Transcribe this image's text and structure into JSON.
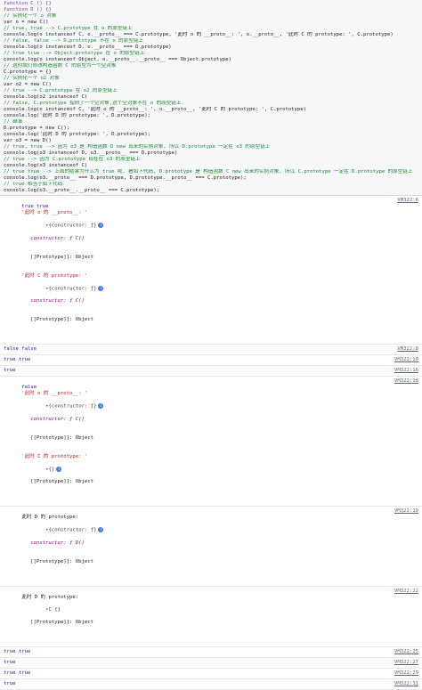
{
  "code_lines": [
    {
      "text": "function C () {}",
      "type": "kw"
    },
    {
      "text": "function D () {}",
      "type": "kw"
    },
    {
      "text": "// 实例化一个 o 对象",
      "type": "comment"
    },
    {
      "text": "var o = new C()",
      "type": "code"
    },
    {
      "text": "// true, true --> C.prototype 在 o 的原型链上",
      "type": "comment"
    },
    {
      "text": "console.log(o instanceof C, o.__proto__ === C.prototype, '此时 o 的 __proto__: ', o.__proto__, '此时 C 的 prototype: ', C.prototype)",
      "type": "code"
    },
    {
      "text": "// false, false --> D.prototype 不在 o 的原型链上",
      "type": "comment"
    },
    {
      "text": "console.log(o instanceof D, o.__proto__ === D.prototype)",
      "type": "code"
    },
    {
      "text": "// true true --> Object.prototype 在 o 的原型链上",
      "type": "comment"
    },
    {
      "text": "console.log(o instanceof Object, o.__proto__.__proto__ === Object.prototype)",
      "type": "code"
    },
    {
      "text": "// 这时我们修改构造函数 C 的原型为一个空对象",
      "type": "comment"
    },
    {
      "text": "C.prototype = {}",
      "type": "code"
    },
    {
      "text": "// 实例化一个 o2 对象",
      "type": "comment"
    },
    {
      "text": "var o2 = new C()",
      "type": "code"
    },
    {
      "text": "// true --> C.prototype 在 o2 的原型链上",
      "type": "comment"
    },
    {
      "text": "console.log(o2 instanceof C)",
      "type": "code"
    },
    {
      "text": "// false, C.prototype 指向了一个空对象,这个空对象不在 o 的原型链上.",
      "type": "comment"
    },
    {
      "text": "console.log(o instanceof C, '此时 o 的 __proto__: ', o.__proto__, '此时 C 的 prototype: ', C.prototype)",
      "type": "code"
    },
    {
      "text": "console.log('此时 D 的 prototype: ', D.prototype);",
      "type": "code"
    },
    {
      "text": "// 继承",
      "type": "comment"
    },
    {
      "text": "D.prototype = new C();",
      "type": "code"
    },
    {
      "text": "console.log('此时 D 的 prototype: ', D.prototype);",
      "type": "code"
    },
    {
      "text": "var o3 = new D()",
      "type": "code"
    },
    {
      "text": "// true, true --> 因为 o3 是 构造函数 D new 出来的实例对象, 所以 D.prototype 一定在 o3 的原型链上",
      "type": "comment"
    },
    {
      "text": "console.log(o3 instanceof D, o3.__proto__ === D.prototype)",
      "type": "code"
    },
    {
      "text": "// true --> 因为 C.prototype 现在在 o3 的原型链上",
      "type": "comment"
    },
    {
      "text": "console.log(o3 instanceof C)",
      "type": "code"
    },
    {
      "text": "// true true --> 上面的结果为什么为 true 呢, 看如下代码, D.prototype 是 构造函数 C new 出来的实例对象, 所以 C.prototype 一定在 D.prototype 的原型链上",
      "type": "comment"
    },
    {
      "text": "console.log(o3.__proto__ === D.prototype, D.prototype.__proto__ === C.prototype);",
      "type": "code"
    },
    {
      "text": "// true 相当于如下代码",
      "type": "comment"
    },
    {
      "text": "console.log(o3.__proto__.__proto__ === C.prototype);",
      "type": "code"
    }
  ],
  "console": {
    "r1": {
      "bools": "true true",
      "label_o": "'此时 o 的 __proto__: '",
      "obj1_head": "{constructor: ƒ}",
      "label_c": "'此时 C 的 prototype: '",
      "obj2_head": "{constructor: ƒ}",
      "constructor_line": "constructor: ƒ C()",
      "proto_line": "[[Prototype]]: Object",
      "src": "VM322:6"
    },
    "r2": {
      "text": "false false",
      "src": "VM322:8"
    },
    "r3": {
      "text": "true true",
      "src": "VM322:10"
    },
    "r4": {
      "text": "true",
      "src": "VM322:16"
    },
    "r5": {
      "bools": "false",
      "label_o": "'此时 o 的 __proto__: '",
      "obj1_head": "{constructor: ƒ}",
      "label_c": "'此时 C 的 prototype: '",
      "obj2_head": "{}",
      "constructor_line": "constructor: ƒ C()",
      "proto_line": "[[Prototype]]: Object",
      "proto2_line": "[[Prototype]]: Object",
      "src": "VM322:18"
    },
    "r6": {
      "label": "此时 D 的 prototype: ",
      "head": "{constructor: ƒ}",
      "constructor_line": "constructor: ƒ D()",
      "proto_line": "[[Prototype]]: Object",
      "src": "VM322:19"
    },
    "r7": {
      "label": "此时 D 的 prototype: ",
      "head": "C {}",
      "proto_line": "[[Prototype]]: Object",
      "src": "VM322:22"
    },
    "r8": {
      "text": "true true",
      "src": "VM322:25"
    },
    "r9": {
      "text": "true",
      "src": "VM322:27"
    },
    "r10": {
      "text": "true true",
      "src": "VM322:29"
    },
    "r11": {
      "text": "true",
      "src": "VM322:31"
    }
  }
}
